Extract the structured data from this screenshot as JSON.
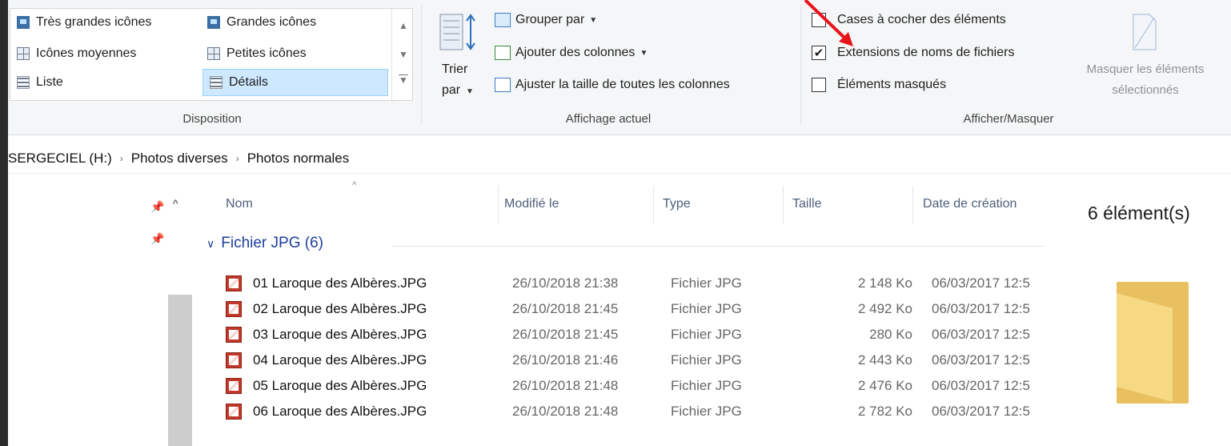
{
  "ribbon": {
    "layout": {
      "items": [
        {
          "label": "Très grandes icônes",
          "icon": "extra-large-icons-icon"
        },
        {
          "label": "Grandes icônes",
          "icon": "large-icons-icon"
        },
        {
          "label": "Icônes moyennes",
          "icon": "medium-icons-icon"
        },
        {
          "label": "Petites icônes",
          "icon": "small-icons-icon"
        },
        {
          "label": "Liste",
          "icon": "list-icon"
        },
        {
          "label": "Détails",
          "icon": "details-icon",
          "selected": true
        }
      ],
      "group_label": "Disposition"
    },
    "current_view": {
      "sort_label_line1": "Trier",
      "sort_label_line2": "par",
      "group_by": "Grouper par",
      "add_columns": "Ajouter des colonnes",
      "size_columns": "Ajuster la taille de toutes les colonnes",
      "group_label": "Affichage actuel"
    },
    "show_hide": {
      "item_checkboxes": {
        "label": "Cases à cocher des éléments",
        "checked": false
      },
      "file_extensions": {
        "label": "Extensions de noms de fichiers",
        "checked": true
      },
      "hidden_items": {
        "label": "Éléments masqués",
        "checked": false
      },
      "hide_selected_line1": "Masquer les éléments",
      "hide_selected_line2": "sélectionnés",
      "group_label": "Afficher/Masquer"
    }
  },
  "breadcrumb": [
    "SERGECIEL (H:)",
    "Photos diverses",
    "Photos normales"
  ],
  "columns": [
    "Nom",
    "Modifié le",
    "Type",
    "Taille",
    "Date de création"
  ],
  "group": {
    "label": "Fichier JPG (6)"
  },
  "files": [
    {
      "name": "01 Laroque des Albères.JPG",
      "modified": "26/10/2018 21:38",
      "type": "Fichier JPG",
      "size": "2 148 Ko",
      "created": "06/03/2017 12:5"
    },
    {
      "name": "02 Laroque des Albères.JPG",
      "modified": "26/10/2018 21:45",
      "type": "Fichier JPG",
      "size": "2 492 Ko",
      "created": "06/03/2017 12:5"
    },
    {
      "name": "03 Laroque des Albères.JPG",
      "modified": "26/10/2018 21:45",
      "type": "Fichier JPG",
      "size": "280 Ko",
      "created": "06/03/2017 12:5"
    },
    {
      "name": "04 Laroque des Albères.JPG",
      "modified": "26/10/2018 21:46",
      "type": "Fichier JPG",
      "size": "2 443 Ko",
      "created": "06/03/2017 12:5"
    },
    {
      "name": "05 Laroque des Albères.JPG",
      "modified": "26/10/2018 21:48",
      "type": "Fichier JPG",
      "size": "2 476 Ko",
      "created": "06/03/2017 12:5"
    },
    {
      "name": "06 Laroque des Albères.JPG",
      "modified": "26/10/2018 21:48",
      "type": "Fichier JPG",
      "size": "2 782 Ko",
      "created": "06/03/2017 12:5"
    }
  ],
  "details_pane": {
    "count": "6 élément(s)"
  },
  "colors": {
    "accent": "#1e3f9c",
    "selection": "#cde8ff",
    "annotation_arrow": "#e8151b",
    "folder": "#f7d983"
  }
}
